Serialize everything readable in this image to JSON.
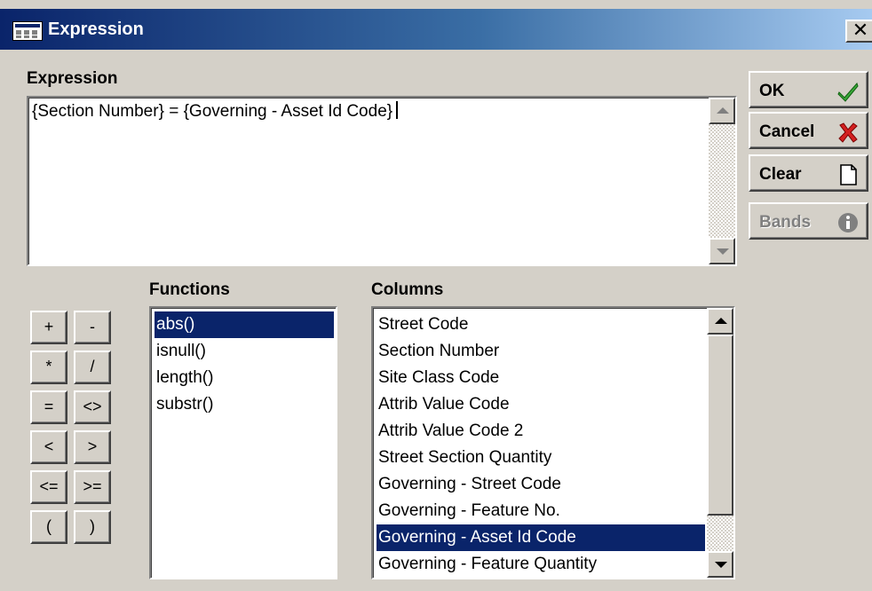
{
  "window": {
    "title": "Expression",
    "close_glyph": "✕",
    "icon": "expression-app-icon"
  },
  "expression": {
    "label": "Expression",
    "value": "{Section Number} = {Governing - Asset Id Code}"
  },
  "buttons": {
    "ok": {
      "label": "OK",
      "icon": "green-checkmark-icon",
      "icon_color": "#3aa83a"
    },
    "cancel": {
      "label": "Cancel",
      "icon": "red-x-icon",
      "icon_color": "#d42020"
    },
    "clear": {
      "label": "Clear",
      "icon": "blank-page-icon"
    },
    "bands": {
      "label": "Bands",
      "icon": "info-icon",
      "disabled": true
    }
  },
  "operators": [
    "+",
    "-",
    "*",
    "/",
    "=",
    "<>",
    "<",
    ">",
    "<=",
    ">=",
    "(",
    ")"
  ],
  "functions": {
    "label": "Functions",
    "items": [
      "abs()",
      "isnull()",
      "length()",
      "substr()"
    ],
    "selected": "abs()"
  },
  "columns": {
    "label": "Columns",
    "items": [
      "Street Code",
      "Section Number",
      "Site Class Code",
      "Attrib Value Code",
      "Attrib Value Code 2",
      "Street Section Quantity",
      "Governing - Street Code",
      "Governing - Feature No.",
      "Governing - Asset Id Code",
      "Governing - Feature Quantity"
    ],
    "selected": "Governing - Asset Id Code"
  },
  "colors": {
    "selection": "#0a246a",
    "title_start": "#0a246a",
    "title_end": "#a6caf0",
    "face": "#d4d0c8"
  }
}
